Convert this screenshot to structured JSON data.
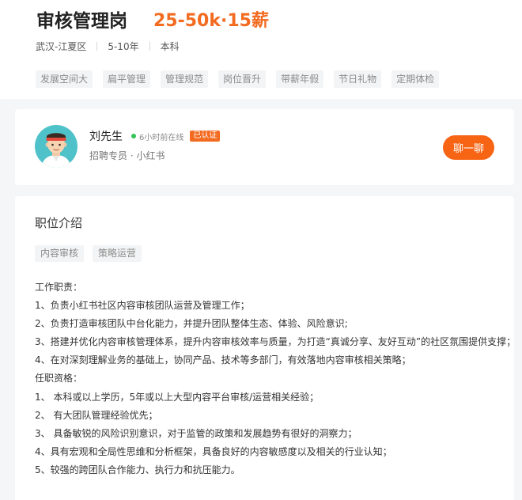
{
  "job": {
    "title": "审核管理岗",
    "salary": "25-50k·15薪",
    "location": "武汉-江夏区",
    "experience": "5-10年",
    "education": "本科",
    "benefit_tags": [
      "发展空间大",
      "扁平管理",
      "管理规范",
      "岗位晋升",
      "带薪年假",
      "节日礼物",
      "定期体检"
    ]
  },
  "recruiter": {
    "name": "刘先生",
    "online_status": "6小时前在线",
    "verified_badge": "已认证",
    "title": "招聘专员 · 小红书",
    "chat_label": "聊一聊",
    "avatar_icon": "recruiter-avatar-icon"
  },
  "description": {
    "heading": "职位介绍",
    "skill_tags": [
      "内容审核",
      "策略运营"
    ],
    "lines": [
      "工作职责：",
      "1、负责小红书社区内容审核团队运营及管理工作；",
      "2、负责打造审核团队中台化能力，并提升团队整体生态、体验、风险意识;",
      "3、搭建并优化内容审核管理体系，提升内容审核效率与质量，为打造“真诚分享、友好互动”的社区氛围提供支撑；",
      "4、在对深刻理解业务的基础上，协同产品、技术等多部门，有效落地内容审核相关策略；",
      "任职资格：",
      "1、 本科或以上学历，5年或以上大型内容平台审核/运营相关经验；",
      "2、 有大团队管理经验优先；",
      "3、 具备敏锐的风险识别意识，对于监管的政策和发展趋势有很好的洞察力；",
      "4、具有宏观和全局性思维和分析框架，具备良好的内容敏感度以及相关的行业认知；",
      "5、较强的跨团队合作能力、执行力和抗压能力。"
    ]
  },
  "colors": {
    "accent": "#f26b20",
    "online": "#33c25a",
    "page_bg": "#f5f6f7"
  }
}
